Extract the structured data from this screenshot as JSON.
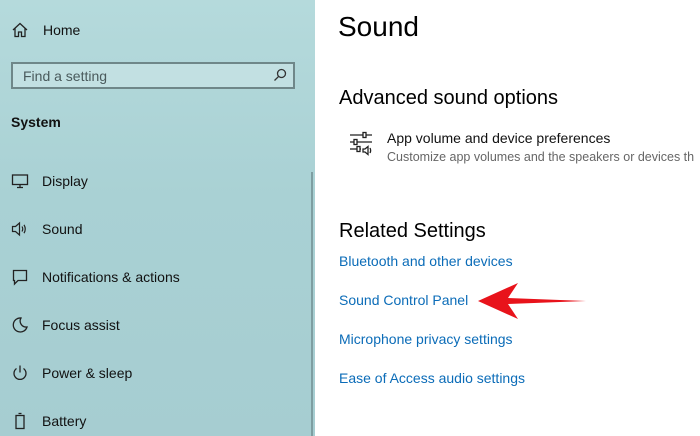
{
  "sidebar": {
    "home_label": "Home",
    "search_placeholder": "Find a setting",
    "section_title": "System",
    "items": [
      {
        "label": "Display",
        "icon": "display-icon"
      },
      {
        "label": "Sound",
        "icon": "speaker-icon"
      },
      {
        "label": "Notifications & actions",
        "icon": "notification-icon"
      },
      {
        "label": "Focus assist",
        "icon": "moon-icon"
      },
      {
        "label": "Power & sleep",
        "icon": "power-icon"
      },
      {
        "label": "Battery",
        "icon": "battery-icon"
      }
    ]
  },
  "main": {
    "title": "Sound",
    "advanced": {
      "heading": "Advanced sound options",
      "item_title": "App volume and device preferences",
      "item_desc": "Customize app volumes and the speakers or devices th"
    },
    "related": {
      "heading": "Related Settings",
      "links": [
        "Bluetooth and other devices",
        "Sound Control Panel",
        "Microphone privacy settings",
        "Ease of Access audio settings"
      ]
    }
  },
  "colors": {
    "sidebar_bg": "#a9d1d4",
    "link": "#0b6cb8",
    "annotation_arrow": "#e8131b"
  }
}
